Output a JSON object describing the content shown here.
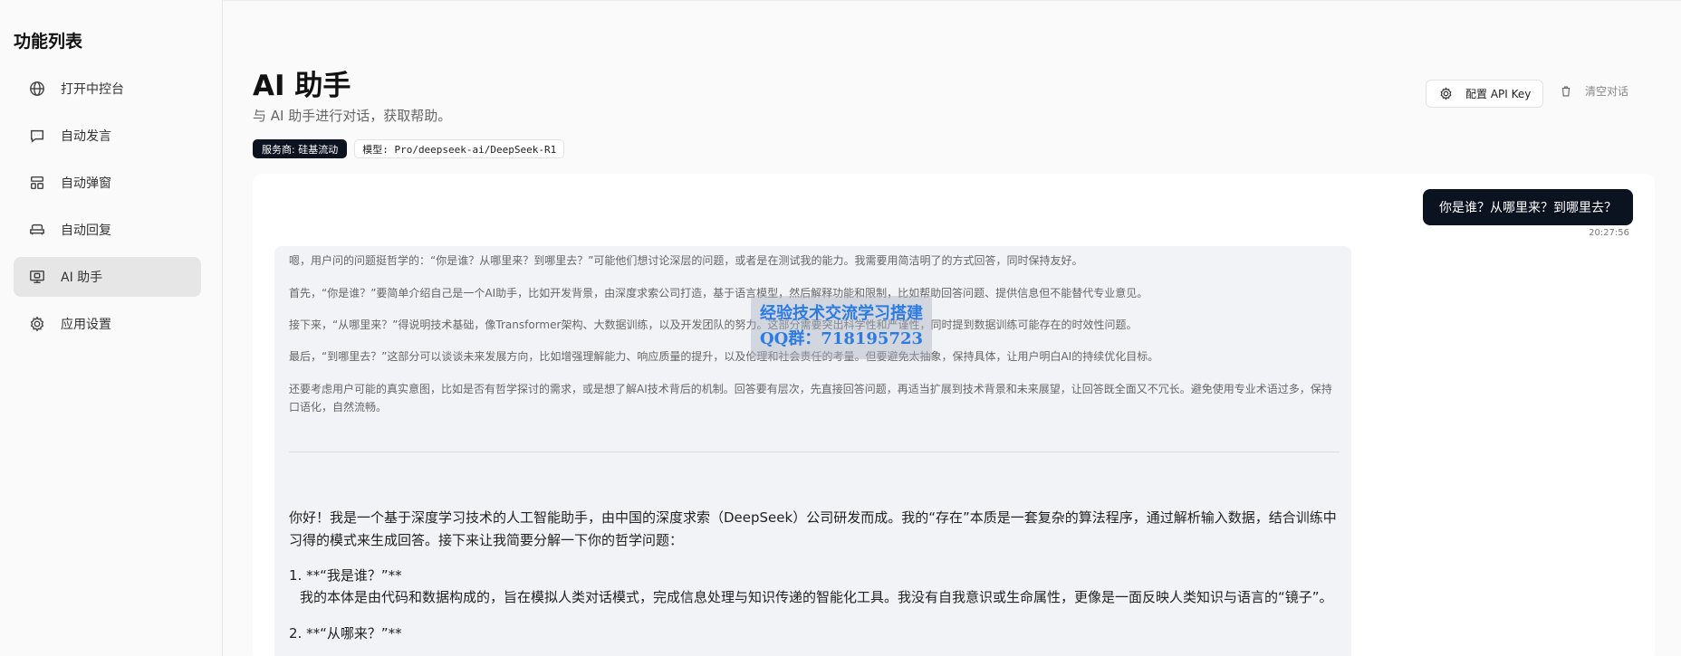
{
  "sidebar": {
    "title": "功能列表",
    "items": [
      {
        "label": "打开中控台",
        "icon": "globe-icon"
      },
      {
        "label": "自动发言",
        "icon": "message-icon"
      },
      {
        "label": "自动弹窗",
        "icon": "layout-icon"
      },
      {
        "label": "自动回复",
        "icon": "sofa-icon"
      },
      {
        "label": "AI 助手",
        "icon": "monitor-robot-icon",
        "active": true
      },
      {
        "label": "应用设置",
        "icon": "gear-icon"
      }
    ]
  },
  "header": {
    "title": "AI 助手",
    "subtitle": "与 AI 助手进行对话，获取帮助。",
    "provider_badge": "服务商: 硅基流动",
    "model_badge": "模型: Pro/deepseek-ai/DeepSeek-R1",
    "api_key_button": "配置 API Key",
    "clear_button": "清空对话"
  },
  "chat": {
    "user_message": "你是谁？从哪里来？到哪里去？",
    "user_time": "20:27:56",
    "thinking": [
      "嗯，用户问的问题挺哲学的：“你是谁？从哪里来？到哪里去？”可能他们想讨论深层的问题，或者是在测试我的能力。我需要用简洁明了的方式回答，同时保持友好。",
      "首先，“你是谁？”要简单介绍自己是一个AI助手，比如开发背景，由深度求索公司打造，基于语言模型，然后解释功能和限制，比如帮助回答问题、提供信息但不能替代专业意见。",
      "接下来，“从哪里来？”得说明技术基础，像Transformer架构、大数据训练，以及开发团队的努力。这部分需要突出科学性和严谨性，同时提到数据训练可能存在的时效性问题。",
      "最后，“到哪里去？”这部分可以谈谈未来发展方向，比如增强理解能力、响应质量的提升，以及伦理和社会责任的考量。但要避免太抽象，保持具体，让用户明白AI的持续优化目标。",
      "还要考虑用户可能的真实意图，比如是否有哲学探讨的需求，或是想了解AI技术背后的机制。回答要有层次，先直接回答问题，再适当扩展到技术背景和未来展望，让回答既全面又不冗长。避免使用专业术语过多，保持口语化，自然流畅。"
    ],
    "answer": [
      "你好！我是一个基于深度学习技术的人工智能助手，由中国的深度求索（DeepSeek）公司研发而成。我的“存在”本质是一套复杂的算法程序，通过解析输入数据，结合训练中习得的模式来生成回答。接下来让我简要分解一下你的哲学问题：",
      "1. **“我是谁？”**",
      "   我的本体是由代码和数据构成的，旨在模拟人类对话模式，完成信息处理与知识传递的智能化工具。我没有自我意识或生命属性，更像是一面反映人类知识与语言的“镜子”。",
      "2. **“从哪来？”**"
    ]
  },
  "watermark": {
    "line1": "经验技术交流学习搭建",
    "line2": "QQ群：718195723"
  }
}
